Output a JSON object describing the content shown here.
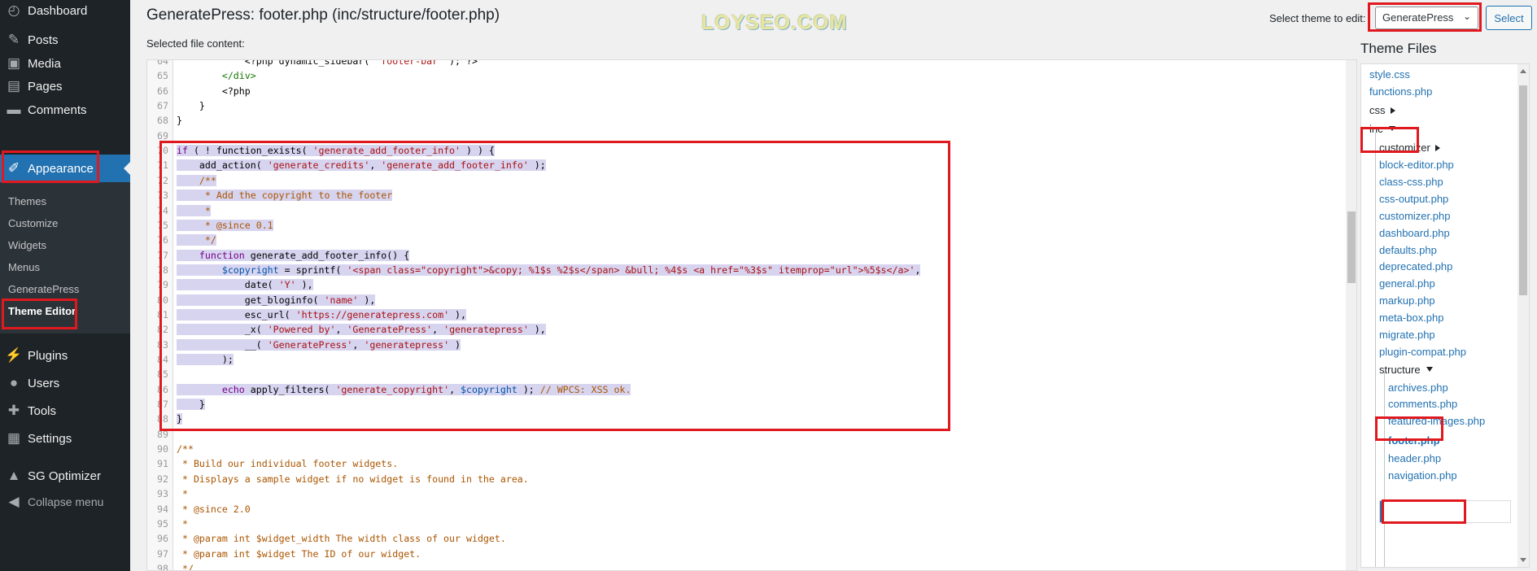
{
  "sidebar": {
    "items": [
      {
        "label": "Dashboard",
        "icon": "dashboard-icon",
        "glyph": "◴"
      },
      {
        "label": "Posts",
        "icon": "pushpin-icon",
        "glyph": "✎"
      },
      {
        "label": "Media",
        "icon": "media-icon",
        "glyph": "▣"
      },
      {
        "label": "Pages",
        "icon": "pages-icon",
        "glyph": "▤"
      },
      {
        "label": "Comments",
        "icon": "comments-icon",
        "glyph": "▬"
      },
      {
        "label": "Appearance",
        "icon": "paintbrush-icon",
        "glyph": "✐"
      },
      {
        "label": "Plugins",
        "icon": "plugins-icon",
        "glyph": "⚡"
      },
      {
        "label": "Users",
        "icon": "users-icon",
        "glyph": "●"
      },
      {
        "label": "Tools",
        "icon": "wrench-icon",
        "glyph": "✚"
      },
      {
        "label": "Settings",
        "icon": "settings-icon",
        "glyph": "▦"
      },
      {
        "label": "SG Optimizer",
        "icon": "sg-optimizer-icon",
        "glyph": "▲"
      }
    ],
    "appearance_submenu": [
      "Themes",
      "Customize",
      "Widgets",
      "Menus",
      "GeneratePress",
      "Theme Editor"
    ],
    "collapse_label": "Collapse menu"
  },
  "header": {
    "title": "GeneratePress: footer.php (inc/structure/footer.php)",
    "selected_file_label": "Selected file content:",
    "watermark": "LOYSEO.COM",
    "theme_select_label": "Select theme to edit:",
    "theme_select_value": "GeneratePress",
    "select_button": "Select"
  },
  "editor": {
    "lines": [
      {
        "n": "64",
        "t": "            <?php dynamic_sidebar( 'footer-bar' ); ?>",
        "sel": false
      },
      {
        "n": "65",
        "t": "        </div>",
        "sel": false
      },
      {
        "n": "66",
        "t": "        <?php",
        "sel": false
      },
      {
        "n": "67",
        "t": "    }",
        "sel": false
      },
      {
        "n": "68",
        "t": "}",
        "sel": false
      },
      {
        "n": "69",
        "t": "",
        "sel": false
      },
      {
        "n": "70",
        "t": "if ( ! function_exists( 'generate_add_footer_info' ) ) {",
        "sel": true
      },
      {
        "n": "71",
        "t": "    add_action( 'generate_credits', 'generate_add_footer_info' );",
        "sel": true
      },
      {
        "n": "72",
        "t": "    /**",
        "sel": true
      },
      {
        "n": "73",
        "t": "     * Add the copyright to the footer",
        "sel": true
      },
      {
        "n": "74",
        "t": "     *",
        "sel": true
      },
      {
        "n": "75",
        "t": "     * @since 0.1",
        "sel": true
      },
      {
        "n": "76",
        "t": "     */",
        "sel": true
      },
      {
        "n": "77",
        "t": "    function generate_add_footer_info() {",
        "sel": true
      },
      {
        "n": "78",
        "t": "        $copyright = sprintf( '<span class=\"copyright\">&copy; %1$s %2$s</span> &bull; %4$s <a href=\"%3$s\" itemprop=\"url\">%5$s</a>',",
        "sel": true
      },
      {
        "n": "79",
        "t": "            date( 'Y' ),",
        "sel": true
      },
      {
        "n": "80",
        "t": "            get_bloginfo( 'name' ),",
        "sel": true
      },
      {
        "n": "81",
        "t": "            esc_url( 'https://generatepress.com' ),",
        "sel": true
      },
      {
        "n": "82",
        "t": "            _x( 'Powered by', 'GeneratePress', 'generatepress' ),",
        "sel": true
      },
      {
        "n": "83",
        "t": "            __( 'GeneratePress', 'generatepress' )",
        "sel": true
      },
      {
        "n": "84",
        "t": "        );",
        "sel": true
      },
      {
        "n": "85",
        "t": "",
        "sel": true
      },
      {
        "n": "86",
        "t": "        echo apply_filters( 'generate_copyright', $copyright ); // WPCS: XSS ok.",
        "sel": true
      },
      {
        "n": "87",
        "t": "    }",
        "sel": true
      },
      {
        "n": "88",
        "t": "}",
        "sel": true
      },
      {
        "n": "89",
        "t": "",
        "sel": false
      },
      {
        "n": "90",
        "t": "/**",
        "sel": false
      },
      {
        "n": "91",
        "t": " * Build our individual footer widgets.",
        "sel": false
      },
      {
        "n": "92",
        "t": " * Displays a sample widget if no widget is found in the area.",
        "sel": false
      },
      {
        "n": "93",
        "t": " *",
        "sel": false
      },
      {
        "n": "94",
        "t": " * @since 2.0",
        "sel": false
      },
      {
        "n": "95",
        "t": " *",
        "sel": false
      },
      {
        "n": "96",
        "t": " * @param int $widget_width The width class of our widget.",
        "sel": false
      },
      {
        "n": "97",
        "t": " * @param int $widget The ID of our widget.",
        "sel": false
      },
      {
        "n": "98",
        "t": " */",
        "sel": false
      }
    ]
  },
  "files": {
    "title": "Theme Files",
    "items": [
      {
        "label": "style.css",
        "kind": "file"
      },
      {
        "label": "functions.php",
        "kind": "file"
      },
      {
        "label": "css",
        "kind": "dir-closed"
      },
      {
        "label": "inc",
        "kind": "dir-open"
      },
      {
        "label": "customizer",
        "kind": "dir-closed"
      },
      {
        "label": "block-editor.php",
        "kind": "file"
      },
      {
        "label": "class-css.php",
        "kind": "file"
      },
      {
        "label": "css-output.php",
        "kind": "file"
      },
      {
        "label": "customizer.php",
        "kind": "file"
      },
      {
        "label": "dashboard.php",
        "kind": "file"
      },
      {
        "label": "defaults.php",
        "kind": "file"
      },
      {
        "label": "deprecated.php",
        "kind": "file"
      },
      {
        "label": "general.php",
        "kind": "file"
      },
      {
        "label": "markup.php",
        "kind": "file"
      },
      {
        "label": "meta-box.php",
        "kind": "file"
      },
      {
        "label": "migrate.php",
        "kind": "file"
      },
      {
        "label": "plugin-compat.php",
        "kind": "file"
      },
      {
        "label": "structure",
        "kind": "dir-open"
      },
      {
        "label": "archives.php",
        "kind": "file"
      },
      {
        "label": "comments.php",
        "kind": "file"
      },
      {
        "label": "featured-images.php",
        "kind": "file"
      },
      {
        "label": "footer.php",
        "kind": "file-current"
      },
      {
        "label": "header.php",
        "kind": "file"
      },
      {
        "label": "navigation.php",
        "kind": "file"
      }
    ]
  },
  "colors": {
    "accent": "#2271b1",
    "sidebar_bg": "#1d2327",
    "annotation": "#e0191f",
    "selection": "#d7d4f0"
  }
}
